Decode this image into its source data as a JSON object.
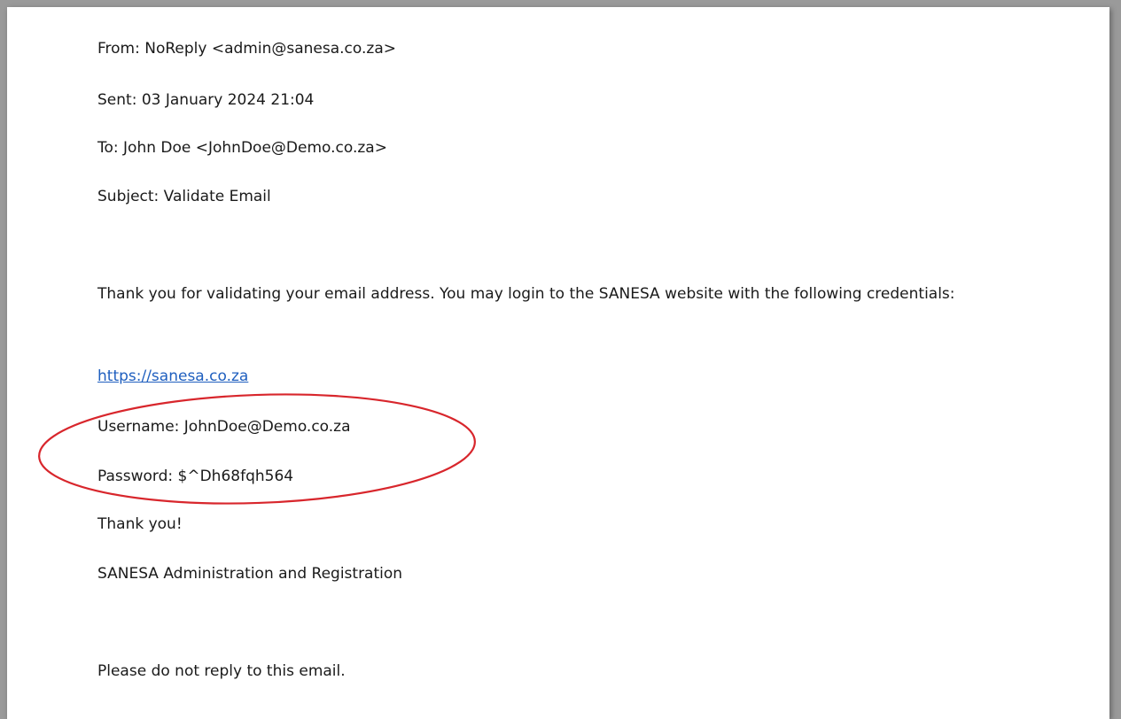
{
  "email": {
    "from": "From: NoReply <admin@sanesa.co.za>",
    "sent": "Sent: 03 January 2024 21:04",
    "to": "To: John Doe <JohnDoe@Demo.co.za>",
    "subject": "Subject: Validate Email",
    "body_intro": "Thank you for validating your email address. You may login to the SANESA website with the following credentials:",
    "link": "https://sanesa.co.za",
    "username": "Username: JohnDoe@Demo.co.za",
    "password": "Password: $^Dh68fqh564",
    "thanks": "Thank you!",
    "signature": "SANESA Administration and Registration",
    "footer": "Please do not reply to this email."
  },
  "colors": {
    "link": "#1f5fbf",
    "highlight_ellipse": "#d8262c"
  }
}
